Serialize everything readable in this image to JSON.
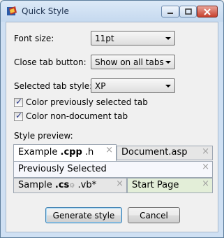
{
  "window": {
    "title": "Quick Style"
  },
  "form": {
    "font_size_label": "Font size:",
    "font_size_value": "11pt",
    "close_tab_label": "Close tab button:",
    "close_tab_value": "Show on all tabs",
    "tab_style_label": "Selected tab style:",
    "tab_style_value": "XP",
    "color_prev_label": "Color previously selected tab",
    "color_nondoc_label": "Color non-document tab",
    "style_preview_label": "Style preview:"
  },
  "preview": {
    "tab1_prefix": "Example ",
    "tab1_bold": ".cpp",
    "tab1_suffix": " .h",
    "tab2": "Document.asp",
    "tab3": "Previously Selected",
    "tab4_prefix": "Sample ",
    "tab4_bold": ".cs",
    "tab4_suffix": " .vb*",
    "tab5": "Start Page",
    "close_glyph": "×"
  },
  "buttons": {
    "generate": "Generate style",
    "cancel": "Cancel"
  },
  "colors": {
    "active_tab": "#ffffff",
    "inactive_tab": "#e6e6e6",
    "prev_selected_tab": "#f6f7fc",
    "nondoc_tab": "#e3eed8"
  }
}
